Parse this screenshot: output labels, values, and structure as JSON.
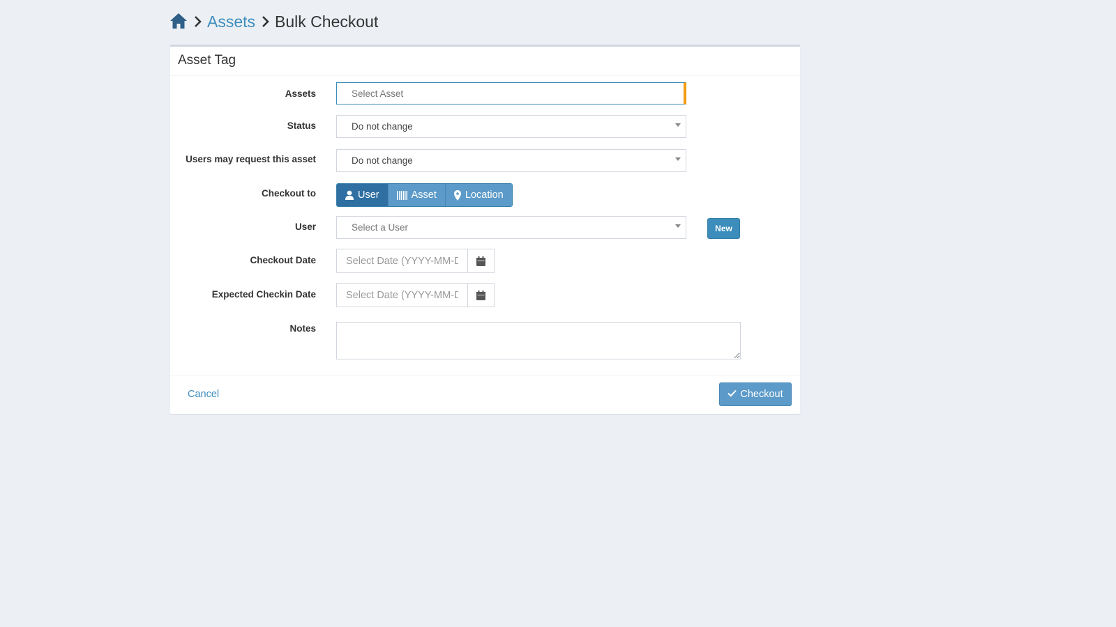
{
  "breadcrumb": {
    "home_icon": "home-icon",
    "separator_icon": "chevron-right-icon",
    "assets_link": "Assets",
    "current": "Bulk Checkout"
  },
  "box": {
    "title": "Asset Tag"
  },
  "form": {
    "assets": {
      "label": "Assets",
      "placeholder": "Select Asset"
    },
    "status": {
      "label": "Status",
      "value": "Do not change"
    },
    "requestable": {
      "label": "Users may request this asset",
      "value": "Do not change"
    },
    "checkout_to": {
      "label": "Checkout to",
      "options": [
        {
          "label": "User",
          "icon": "user-icon",
          "active": true
        },
        {
          "label": "Asset",
          "icon": "barcode-icon",
          "active": false
        },
        {
          "label": "Location",
          "icon": "map-marker-icon",
          "active": false
        }
      ]
    },
    "user": {
      "label": "User",
      "placeholder": "Select a User",
      "new_button": "New"
    },
    "checkout_date": {
      "label": "Checkout Date",
      "placeholder": "Select Date (YYYY-MM-DD)",
      "icon": "calendar-icon"
    },
    "expected_checkin": {
      "label": "Expected Checkin Date",
      "placeholder": "Select Date (YYYY-MM-DD)",
      "icon": "calendar-icon"
    },
    "notes": {
      "label": "Notes",
      "value": ""
    }
  },
  "footer": {
    "cancel": "Cancel",
    "checkout": "Checkout",
    "checkout_icon": "check-icon"
  },
  "colors": {
    "background": "#ecf0f5",
    "primary": "#3c8dbc",
    "active_segment": "#2f6fa2",
    "focus_accent": "#f39c12"
  }
}
